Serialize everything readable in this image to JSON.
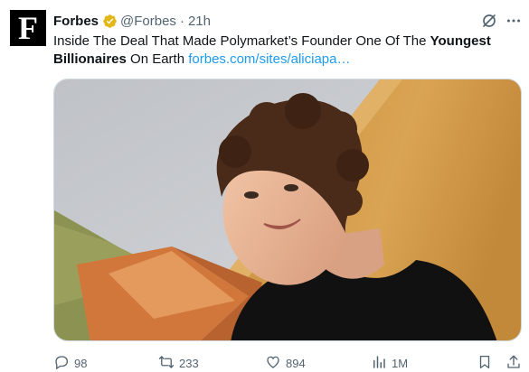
{
  "tweet": {
    "author_avatar_letter": "F",
    "author_name": "Forbes",
    "handle": "@Forbes",
    "separator": "·",
    "time": "21h",
    "text_part1": "Inside The Deal That Made Polymarket’s Founder One Of The ",
    "text_bold1": "Youngest Billionaires",
    "text_part2": " On Earth ",
    "link": "forbes.com/sites/aliciapa…",
    "verified_color": "#e2b719",
    "link_color": "#1d9bf0"
  },
  "icons": {
    "verified": "gold-verified-badge-icon",
    "grok": "grok-icon",
    "more": "more-icon",
    "reply": "reply-icon",
    "retweet": "retweet-icon",
    "like": "heart-icon",
    "views": "views-bar-chart-icon",
    "bookmark": "bookmark-icon",
    "share": "share-icon"
  },
  "actions": {
    "replies": "98",
    "retweets": "233",
    "likes": "894",
    "views": "1M"
  }
}
